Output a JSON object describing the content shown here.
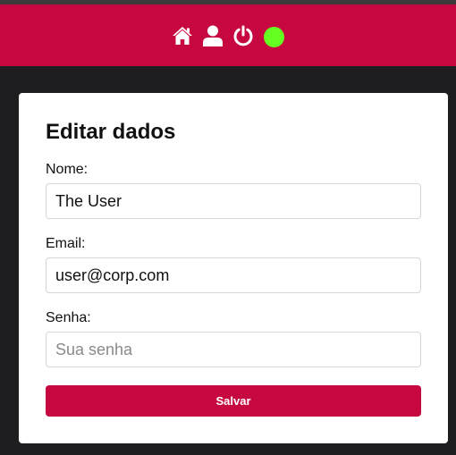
{
  "navbar": {
    "background": "#c70840",
    "icons": [
      {
        "name": "home-icon"
      },
      {
        "name": "user-icon"
      },
      {
        "name": "power-icon"
      }
    ],
    "status_color": "#66ff22"
  },
  "form": {
    "title": "Editar dados",
    "fields": [
      {
        "label": "Nome:",
        "value": "The User",
        "placeholder": ""
      },
      {
        "label": "Email:",
        "value": "user@corp.com",
        "placeholder": ""
      },
      {
        "label": "Senha:",
        "value": "",
        "placeholder": "Sua senha"
      }
    ],
    "submit_label": "Salvar",
    "accent": "#c70840"
  }
}
